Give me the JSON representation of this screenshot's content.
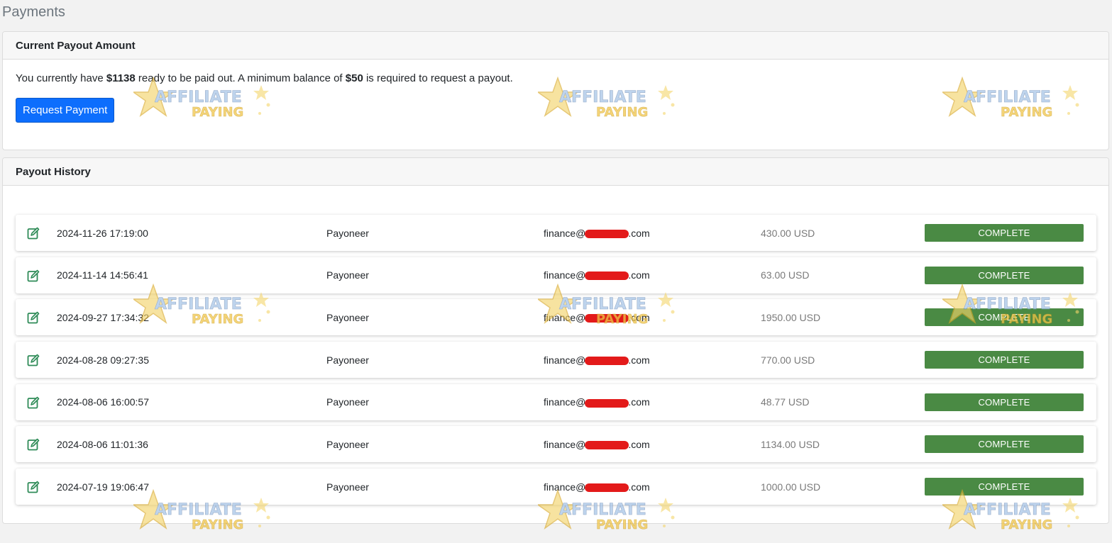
{
  "page": {
    "title": "Payments"
  },
  "payout": {
    "header": "Current Payout Amount",
    "text_before": "You currently have ",
    "amount": "$1138",
    "text_middle": " ready to be paid out. A minimum balance of ",
    "minimum": "$50",
    "text_after": " is required to request a payout.",
    "button_label": "Request Payment"
  },
  "history": {
    "header": "Payout History",
    "rows": [
      {
        "date": "2024-11-26 17:19:00",
        "method": "Payoneer",
        "email_prefix": "finance@",
        "email_suffix": ".com",
        "amount": "430.00 USD",
        "status": "COMPLETE"
      },
      {
        "date": "2024-11-14 14:56:41",
        "method": "Payoneer",
        "email_prefix": "finance@",
        "email_suffix": ".com",
        "amount": "63.00 USD",
        "status": "COMPLETE"
      },
      {
        "date": "2024-09-27 17:34:32",
        "method": "Payoneer",
        "email_prefix": "finance@",
        "email_suffix": ".com",
        "amount": "1950.00 USD",
        "status": "COMPLETE"
      },
      {
        "date": "2024-08-28 09:27:35",
        "method": "Payoneer",
        "email_prefix": "finance@",
        "email_suffix": ".com",
        "amount": "770.00 USD",
        "status": "COMPLETE"
      },
      {
        "date": "2024-08-06 16:00:57",
        "method": "Payoneer",
        "email_prefix": "finance@",
        "email_suffix": ".com",
        "amount": "48.77 USD",
        "status": "COMPLETE"
      },
      {
        "date": "2024-08-06 11:01:36",
        "method": "Payoneer",
        "email_prefix": "finance@",
        "email_suffix": ".com",
        "amount": "1134.00 USD",
        "status": "COMPLETE"
      },
      {
        "date": "2024-07-19 19:06:47",
        "method": "Payoneer",
        "email_prefix": "finance@",
        "email_suffix": ".com",
        "amount": "1000.00 USD",
        "status": "COMPLETE"
      }
    ]
  },
  "watermark": {
    "line1": "AFFILIATE",
    "line2": "PAYING"
  },
  "colors": {
    "primary": "#0d6efd",
    "status_complete": "#4a8a44",
    "edit_icon": "#2e8b57",
    "redaction": "#e31a1a"
  }
}
